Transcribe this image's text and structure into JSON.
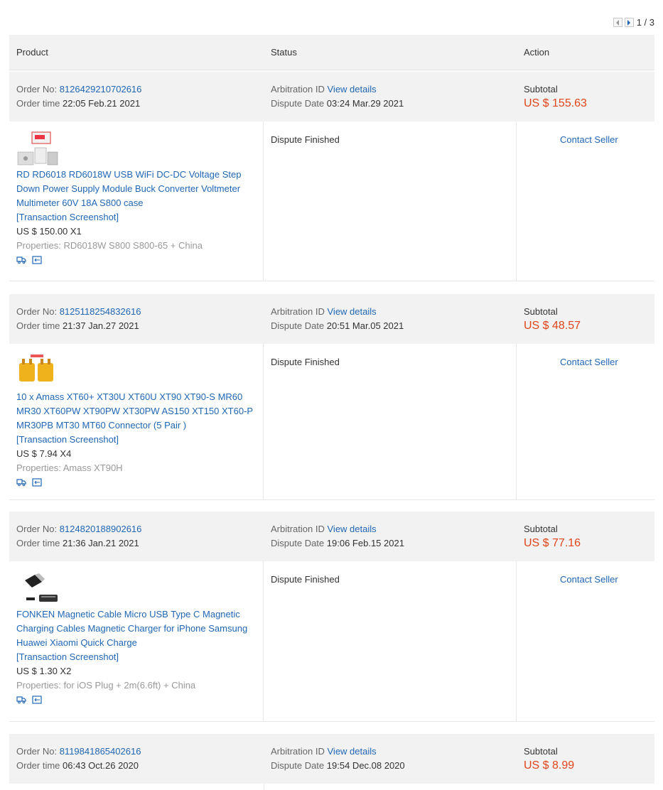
{
  "pager": {
    "text": "1 / 3"
  },
  "header": {
    "product": "Product",
    "status": "Status",
    "action": "Action"
  },
  "labels": {
    "order_no": "Order No:",
    "order_time": "Order time",
    "arbitration_id": "Arbitration ID",
    "view_details": "View details",
    "dispute_date": "Dispute Date",
    "subtotal": "Subtotal",
    "contact_seller": "Contact Seller",
    "transaction_screenshot": "[Transaction Screenshot]"
  },
  "orders": [
    {
      "order_no": "8126429210702616",
      "order_time": "22:05 Feb.21 2021",
      "dispute_date": "03:24 Mar.29 2021",
      "subtotal": "US $ 155.63",
      "status": "Dispute Finished",
      "product_title": "RD RD6018 RD6018W USB WiFi DC-DC Voltage Step Down Power Supply Module Buck Converter Voltmeter Multimeter 60V 18A S800 case",
      "price_qty": "US $ 150.00 X1",
      "properties": "Properties: RD6018W S800 S800-65 + China"
    },
    {
      "order_no": "8125118254832616",
      "order_time": "21:37 Jan.27 2021",
      "dispute_date": "20:51 Mar.05 2021",
      "subtotal": "US $ 48.57",
      "status": "Dispute Finished",
      "product_title": "10 x Amass XT60+ XT30U XT60U XT90 XT90-S MR60 MR30 XT60PW XT90PW XT30PW AS150 XT150 XT60-P MR30PB MT30 MT60 Connector (5 Pair )",
      "price_qty": "US $ 7.94 X4",
      "properties": "Properties: Amass XT90H"
    },
    {
      "order_no": "8124820188902616",
      "order_time": "21:36 Jan.21 2021",
      "dispute_date": "19:06 Feb.15 2021",
      "subtotal": "US $ 77.16",
      "status": "Dispute Finished",
      "product_title": "FONKEN Magnetic Cable Micro USB Type C Magnetic Charging Cables Magnetic Charger for iPhone Samsung Huawei Xiaomi Quick Charge",
      "price_qty": "US $ 1.30 X2",
      "properties": "Properties: for iOS Plug + 2m(6.6ft) + China"
    },
    {
      "order_no": "8119841865402616",
      "order_time": "06:43 Oct.26 2020",
      "dispute_date": "19:54 Dec.08 2020",
      "subtotal": "US $ 8.99"
    }
  ]
}
